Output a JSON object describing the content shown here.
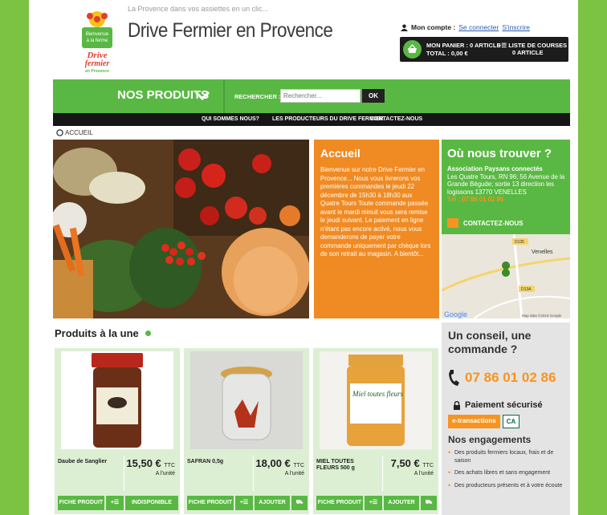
{
  "site": {
    "tagline": "La Provence dans vos assiettes en un clic...",
    "title": "Drive Fermier en Provence",
    "logo_text": [
      "Bienvenue",
      "à la ferme",
      "Drive",
      "fermier",
      "en Provence"
    ]
  },
  "account": {
    "label": "Mon compte :",
    "login": "Se connecter",
    "register": "S'inscrire"
  },
  "cart": {
    "line1": "MON PANIER : 0 ARTICLE",
    "line2": "TOTAL : 0,00 €",
    "list_line1": "LISTE DE COURSES",
    "list_line2": "0 ARTICLE"
  },
  "nav": {
    "products": "NOS PRODUITS",
    "search_label": "RECHERCHER :",
    "search_placeholder": "Rechercher...",
    "search_button": "OK"
  },
  "subnav": [
    "QUI SOMMES NOUS?",
    "LES PRODUCTEURS DU DRIVE FERMIER",
    "CONTACTEZ-NOUS"
  ],
  "breadcrumb": "ACCUEIL",
  "welcome": {
    "title": "Accueil",
    "text": "Bienvenue sur notre Drive Fermier en Provence... Nous vous livrerons vos premières commandes le jeudi 22 décembre de 15h30 à 18h30 aux Quatre Tours Toute commande passée avant le mardi minuit vous sera remise le jeudi suivant. Le paiement en ligne n'étant pas encore activé, nous vous demanderons de payer votre commande uniquement par chèque lors de son retrait au magasin. A bientôt..."
  },
  "location": {
    "title": "Où nous trouver ?",
    "org": "Association Paysans connectés",
    "address": "Les Quatre Tours, RN 96; 56 Avenue de la Grande Bégude; sortie 13 direction les logissons 13770 VENELLES",
    "phone": "Tél : 07 86 01 02 86",
    "contact": "CONTACTEZ-NOUS",
    "map_labels": [
      "D135",
      "Venelles",
      "D13A",
      "Google",
      "Map data ©2016 Google"
    ]
  },
  "featured": {
    "title": "Produits à la une",
    "products": [
      {
        "name": "Daube de Sanglier",
        "price": "15,50 €",
        "tax": "TTC",
        "unit": "A l'unité",
        "btn_detail": "FICHE PRODUIT",
        "btn_add": "INDISPONIBLE"
      },
      {
        "name": "SAFRAN 0,5g",
        "price": "18,00 €",
        "tax": "TTC",
        "unit": "A l'unité",
        "btn_detail": "FICHE PRODUIT",
        "btn_add": "AJOUTER"
      },
      {
        "name": "MIEL TOUTES FLEURS 500 g",
        "price": "7,50 €",
        "tax": "TTC",
        "unit": "A l'unité",
        "btn_detail": "FICHE PRODUIT",
        "btn_add": "AJOUTER"
      }
    ]
  },
  "sidebar": {
    "advice": "Un conseil, une commande ?",
    "phone": "07 86 01 02 86",
    "secure": "Paiement sécurisé",
    "payment_1": "e-transactions",
    "payment_2": "CA",
    "engagements_title": "Nos engagements",
    "engagements": [
      "Des produits fermiers locaux, frais et de saison",
      "Des achats libres et sans engagement",
      "Des producteurs présents et à votre écoute"
    ]
  },
  "colors": {
    "green": "#59b843",
    "orange": "#f08a22",
    "dark": "#1c1c1c"
  }
}
